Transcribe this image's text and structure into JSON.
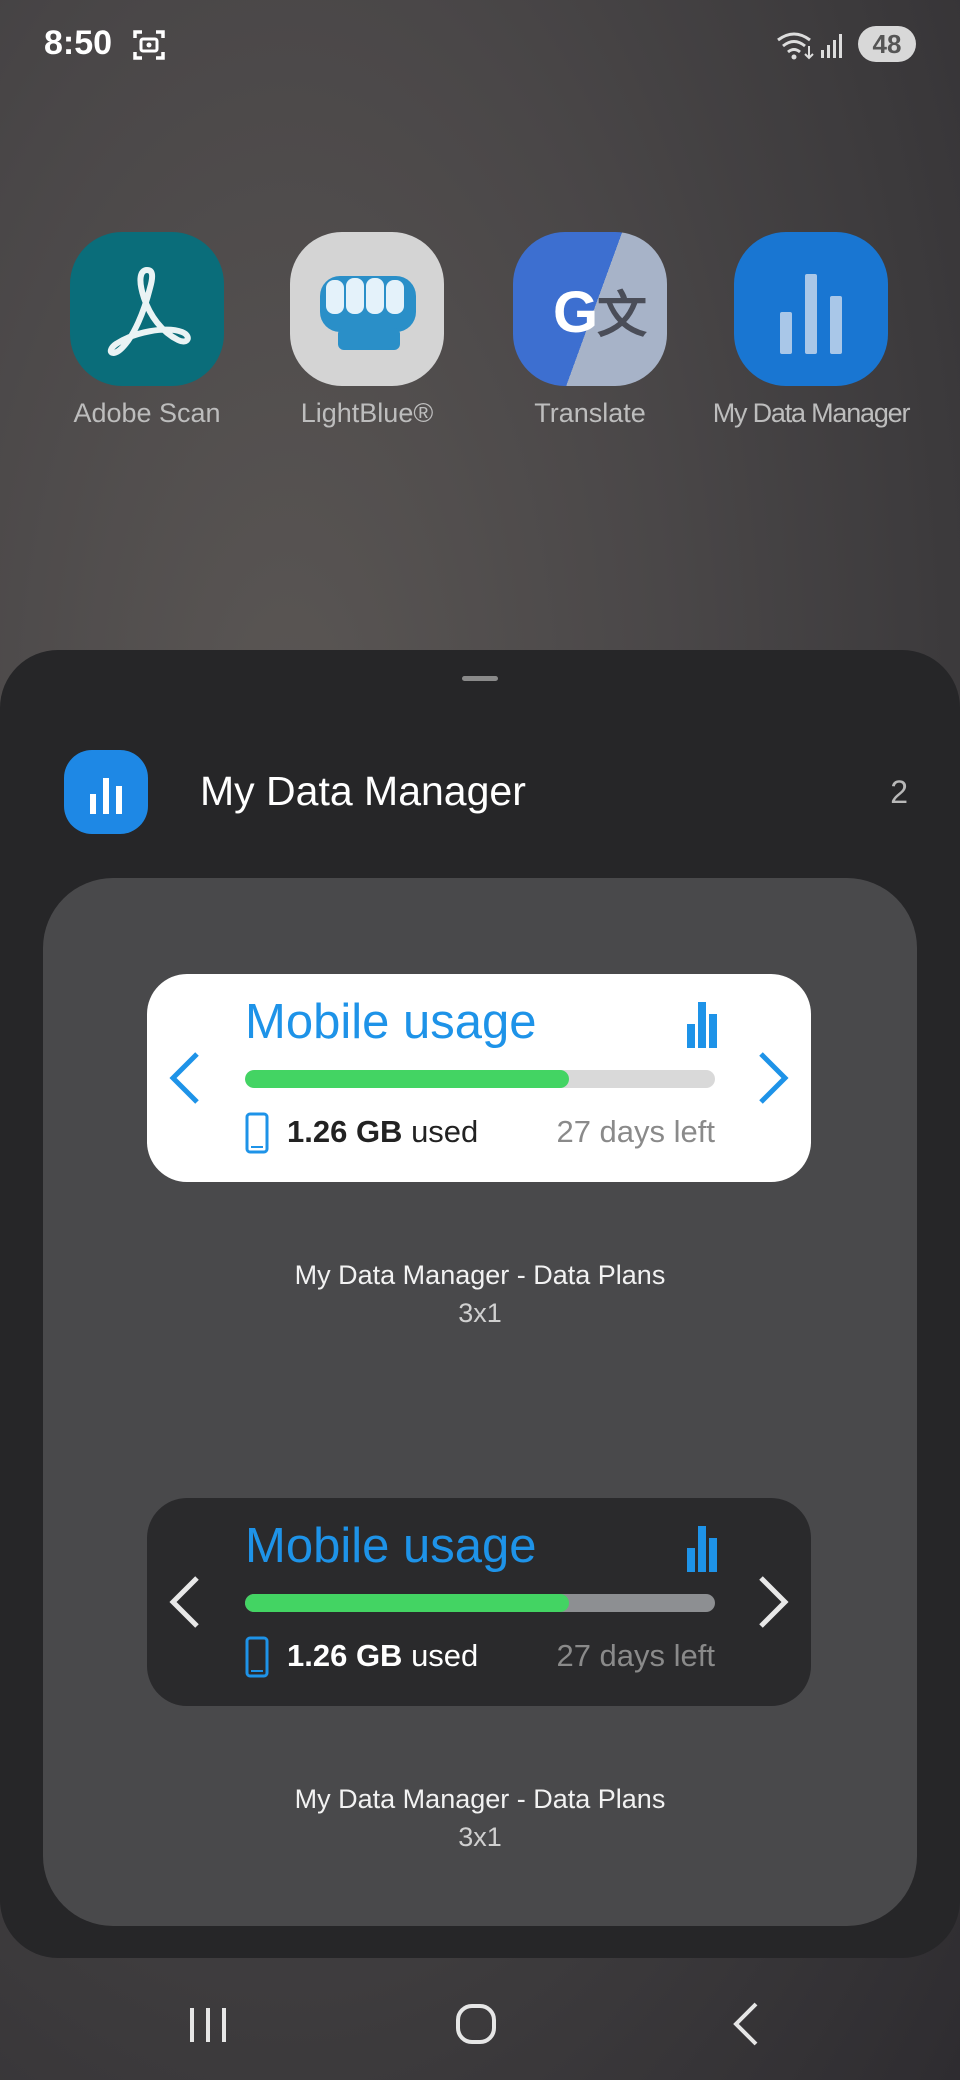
{
  "status_bar": {
    "time": "8:50",
    "battery": "48",
    "icons": [
      "screenshot-icon",
      "wifi-icon",
      "signal-icon"
    ]
  },
  "apps": [
    {
      "label": "Adobe Scan",
      "icon": "adobe-scan-icon"
    },
    {
      "label": "LightBlue®",
      "icon": "lightblue-fist-icon"
    },
    {
      "label": "Translate",
      "icon": "google-translate-icon"
    },
    {
      "label": "My Data Manager",
      "icon": "data-manager-icon"
    }
  ],
  "sheet": {
    "title": "My Data Manager",
    "count": "2"
  },
  "widgets": [
    {
      "theme": "light",
      "title": "Mobile usage",
      "used_amount": "1.26 GB",
      "used_suffix": " used",
      "days_left": "27 days left",
      "progress_percent": 69,
      "caption_name": "My Data Manager - Data Plans",
      "caption_size": "3x1"
    },
    {
      "theme": "dark",
      "title": "Mobile usage",
      "used_amount": "1.26 GB",
      "used_suffix": " used",
      "days_left": "27 days left",
      "progress_percent": 69,
      "caption_name": "My Data Manager - Data Plans",
      "caption_size": "3x1"
    }
  ],
  "colors": {
    "accent_blue": "#1e93e8",
    "progress_green": "#43d463",
    "sheet_bg": "#262628",
    "panel_bg": "#49494b"
  },
  "nav": [
    "recents-button",
    "home-button",
    "back-button"
  ]
}
